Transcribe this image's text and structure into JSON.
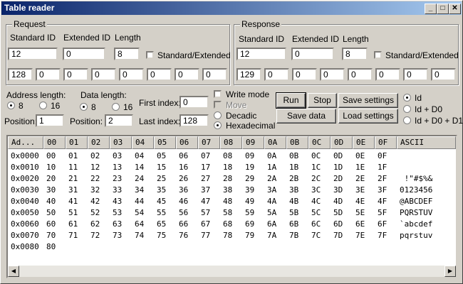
{
  "window": {
    "title": "Table reader",
    "min_icon": "minimize-icon",
    "max_icon": "maximize-icon",
    "close_icon": "close-icon"
  },
  "request": {
    "legend": "Request",
    "standard_id_label": "Standard ID",
    "extended_id_label": "Extended ID",
    "length_label": "Length",
    "standard_id": "12",
    "extended_id": "0",
    "length": "8",
    "std_ext_label": "Standard/Extended",
    "bytes": [
      "128",
      "0",
      "0",
      "0",
      "0",
      "0",
      "0",
      "0"
    ]
  },
  "response": {
    "legend": "Response",
    "standard_id_label": "Standard ID",
    "extended_id_label": "Extended ID",
    "length_label": "Length",
    "standard_id": "12",
    "extended_id": "0",
    "length": "8",
    "std_ext_label": "Standard/Extended",
    "bytes": [
      "129",
      "0",
      "0",
      "0",
      "0",
      "0",
      "0",
      "0"
    ]
  },
  "controls": {
    "address_length_label": "Address length:",
    "addr_opt_8": "8",
    "addr_opt_16": "16",
    "data_length_label": "Data length:",
    "data_opt_8": "8",
    "data_opt_16": "16",
    "position_label": "Position:",
    "position1": "1",
    "position2": "2",
    "first_index_label": "First index:",
    "first_index": "0",
    "last_index_label": "Last index:",
    "last_index": "128",
    "write_mode_label": "Write mode",
    "move_label": "Move",
    "decadic_label": "Decadic",
    "hexadecimal_label": "Hexadecimal",
    "run": "Run",
    "stop": "Stop",
    "save_settings": "Save settings",
    "save_data": "Save data",
    "load_settings": "Load settings",
    "id_opt": "Id",
    "id_d0_opt": "Id + D0",
    "id_d0_d1_opt": "Id + D0 + D1"
  },
  "table": {
    "headers": [
      "Ad...",
      "00",
      "01",
      "02",
      "03",
      "04",
      "05",
      "06",
      "07",
      "08",
      "09",
      "0A",
      "0B",
      "0C",
      "0D",
      "0E",
      "0F",
      "ASCII"
    ],
    "rows": [
      [
        "0x0000",
        "00",
        "01",
        "02",
        "03",
        "04",
        "05",
        "06",
        "07",
        "08",
        "09",
        "0A",
        "0B",
        "0C",
        "0D",
        "0E",
        "0F",
        ""
      ],
      [
        "0x0010",
        "10",
        "11",
        "12",
        "13",
        "14",
        "15",
        "16",
        "17",
        "18",
        "19",
        "1A",
        "1B",
        "1C",
        "1D",
        "1E",
        "1F",
        ""
      ],
      [
        "0x0020",
        "20",
        "21",
        "22",
        "23",
        "24",
        "25",
        "26",
        "27",
        "28",
        "29",
        "2A",
        "2B",
        "2C",
        "2D",
        "2E",
        "2F",
        " !\"#$%&"
      ],
      [
        "0x0030",
        "30",
        "31",
        "32",
        "33",
        "34",
        "35",
        "36",
        "37",
        "38",
        "39",
        "3A",
        "3B",
        "3C",
        "3D",
        "3E",
        "3F",
        "0123456"
      ],
      [
        "0x0040",
        "40",
        "41",
        "42",
        "43",
        "44",
        "45",
        "46",
        "47",
        "48",
        "49",
        "4A",
        "4B",
        "4C",
        "4D",
        "4E",
        "4F",
        "@ABCDEF"
      ],
      [
        "0x0050",
        "50",
        "51",
        "52",
        "53",
        "54",
        "55",
        "56",
        "57",
        "58",
        "59",
        "5A",
        "5B",
        "5C",
        "5D",
        "5E",
        "5F",
        "PQRSTUV"
      ],
      [
        "0x0060",
        "60",
        "61",
        "62",
        "63",
        "64",
        "65",
        "66",
        "67",
        "68",
        "69",
        "6A",
        "6B",
        "6C",
        "6D",
        "6E",
        "6F",
        "`abcdef"
      ],
      [
        "0x0070",
        "70",
        "71",
        "72",
        "73",
        "74",
        "75",
        "76",
        "77",
        "78",
        "79",
        "7A",
        "7B",
        "7C",
        "7D",
        "7E",
        "7F",
        "pqrstuv"
      ],
      [
        "0x0080",
        "80",
        "",
        "",
        "",
        "",
        "",
        "",
        "",
        "",
        "",
        "",
        "",
        "",
        "",
        "",
        "",
        ""
      ]
    ]
  }
}
